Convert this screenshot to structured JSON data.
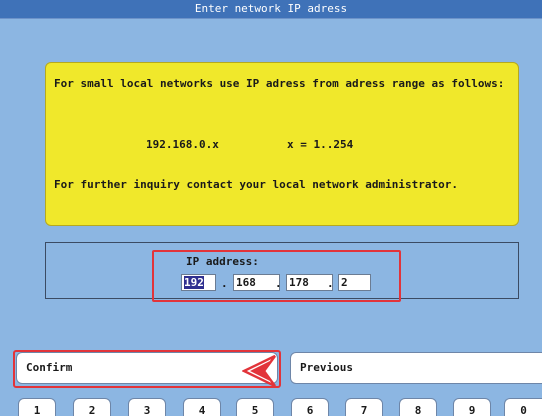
{
  "window": {
    "title": "Enter network IP adress"
  },
  "info": {
    "intro": "For small local networks use IP adress from adress range as follows:",
    "range": "192.168.0.x",
    "x_range": "x = 1..254",
    "inquiry": "For further inquiry contact your local network administrator."
  },
  "ip": {
    "label": "IP address:",
    "octets": [
      "192",
      "168",
      "178",
      "2"
    ],
    "separator": "."
  },
  "buttons": {
    "confirm": "Confirm",
    "previous": "Previous"
  },
  "keypad": [
    "1",
    "2",
    "3",
    "4",
    "5",
    "6",
    "7",
    "8",
    "9",
    "0"
  ],
  "colors": {
    "background": "#8cb6e2",
    "titlebar": "#3f72b8",
    "info_panel": "#f0e82b",
    "highlight": "#e2343a"
  }
}
